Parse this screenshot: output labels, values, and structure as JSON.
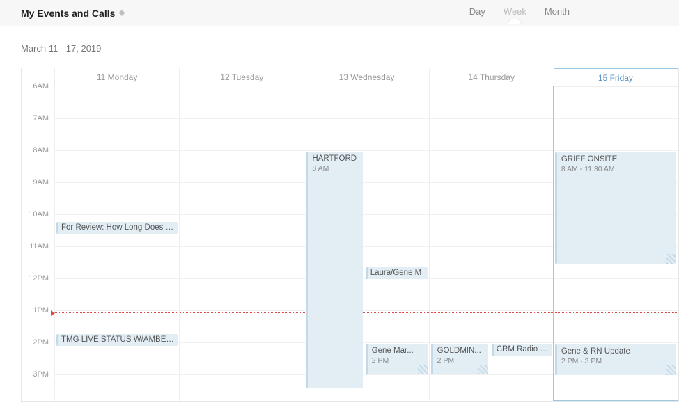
{
  "header": {
    "title": "My Events and Calls",
    "views": {
      "day": "Day",
      "week": "Week",
      "month": "Month",
      "active": "week"
    }
  },
  "date_range": "March 11 - 17, 2019",
  "hours": [
    "6AM",
    "7AM",
    "8AM",
    "9AM",
    "10AM",
    "11AM",
    "12PM",
    "1PM",
    "2PM",
    "3PM"
  ],
  "days": [
    {
      "label": "11 Monday",
      "today": false
    },
    {
      "label": "12 Tuesday",
      "today": false
    },
    {
      "label": "13 Wednesday",
      "today": false
    },
    {
      "label": "14 Thursday",
      "today": false
    },
    {
      "label": "15 Friday",
      "today": true
    }
  ],
  "now": {
    "hour": 13,
    "minute": 5
  },
  "events": {
    "mon": {
      "review": {
        "title": "For Review: How Long Does It T…"
      },
      "tmg": {
        "title": "TMG LIVE STATUS W/AMBER AN"
      }
    },
    "wed": {
      "hartford": {
        "title": "HARTFORD",
        "time": "8 AM"
      },
      "laura_gene": {
        "title": "Laura/Gene M"
      },
      "gene_mar": {
        "title": "Gene Mar...",
        "time": "2 PM"
      }
    },
    "thu": {
      "goldmin": {
        "title": "GOLDMIN...",
        "time": "2 PM"
      },
      "crm": {
        "title": "CRM Radio Po"
      }
    },
    "fri": {
      "griff": {
        "title": "GRIFF ONSITE",
        "time": "8 AM - 11:30 AM"
      },
      "gene_rn": {
        "title": "Gene & RN Update",
        "time": "2 PM - 3 PM"
      }
    }
  }
}
